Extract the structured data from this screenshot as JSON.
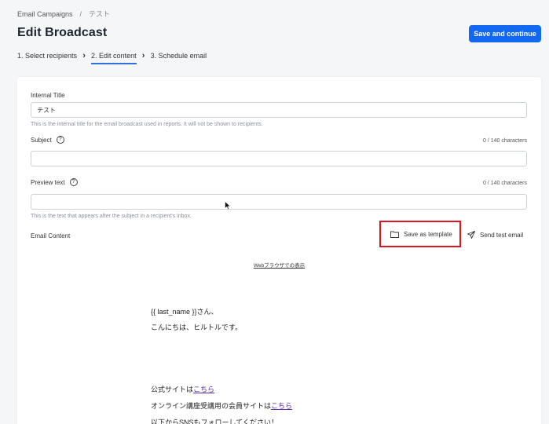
{
  "breadcrumb": {
    "parent": "Email Campaigns",
    "separator": "/",
    "current": "テスト"
  },
  "header": {
    "title": "Edit Broadcast",
    "primary_button": "Save and continue"
  },
  "steps": [
    {
      "label": "1. Select recipients",
      "active": false
    },
    {
      "label": "2. Edit content",
      "active": true
    },
    {
      "label": "3. Schedule email",
      "active": false
    }
  ],
  "form": {
    "internal_title": {
      "label": "Internal Title",
      "value": "テスト",
      "hint": "This is the internal title for the email broadcast used in reports. It will not be shown to recipients."
    },
    "subject": {
      "label": "Subject",
      "counter": "0 / 140 characters",
      "value": ""
    },
    "preview_text": {
      "label": "Preview text",
      "counter": "0 / 140 characters",
      "value": "",
      "hint": "This is the text that appears after the subject in a recipient's inbox."
    }
  },
  "email_content": {
    "label": "Email Content",
    "save_template": "Save as template",
    "send_test": "Send test email",
    "web_link": "Webブラウザでの表示",
    "lines": {
      "greeting": "{{ last_name }}さん、",
      "intro": "こんにちは、ヒルトルです。",
      "official_prefix": "公式サイトは",
      "official_link": "こちら",
      "member_prefix": "オンライン講座受講用の会員サイトは",
      "member_link": "こちら",
      "sns": "以下からSNSもフォローしてください！"
    }
  },
  "colors": {
    "primary": "#1268f3",
    "highlight": "#e0141e",
    "link": "#5b2ea6"
  }
}
